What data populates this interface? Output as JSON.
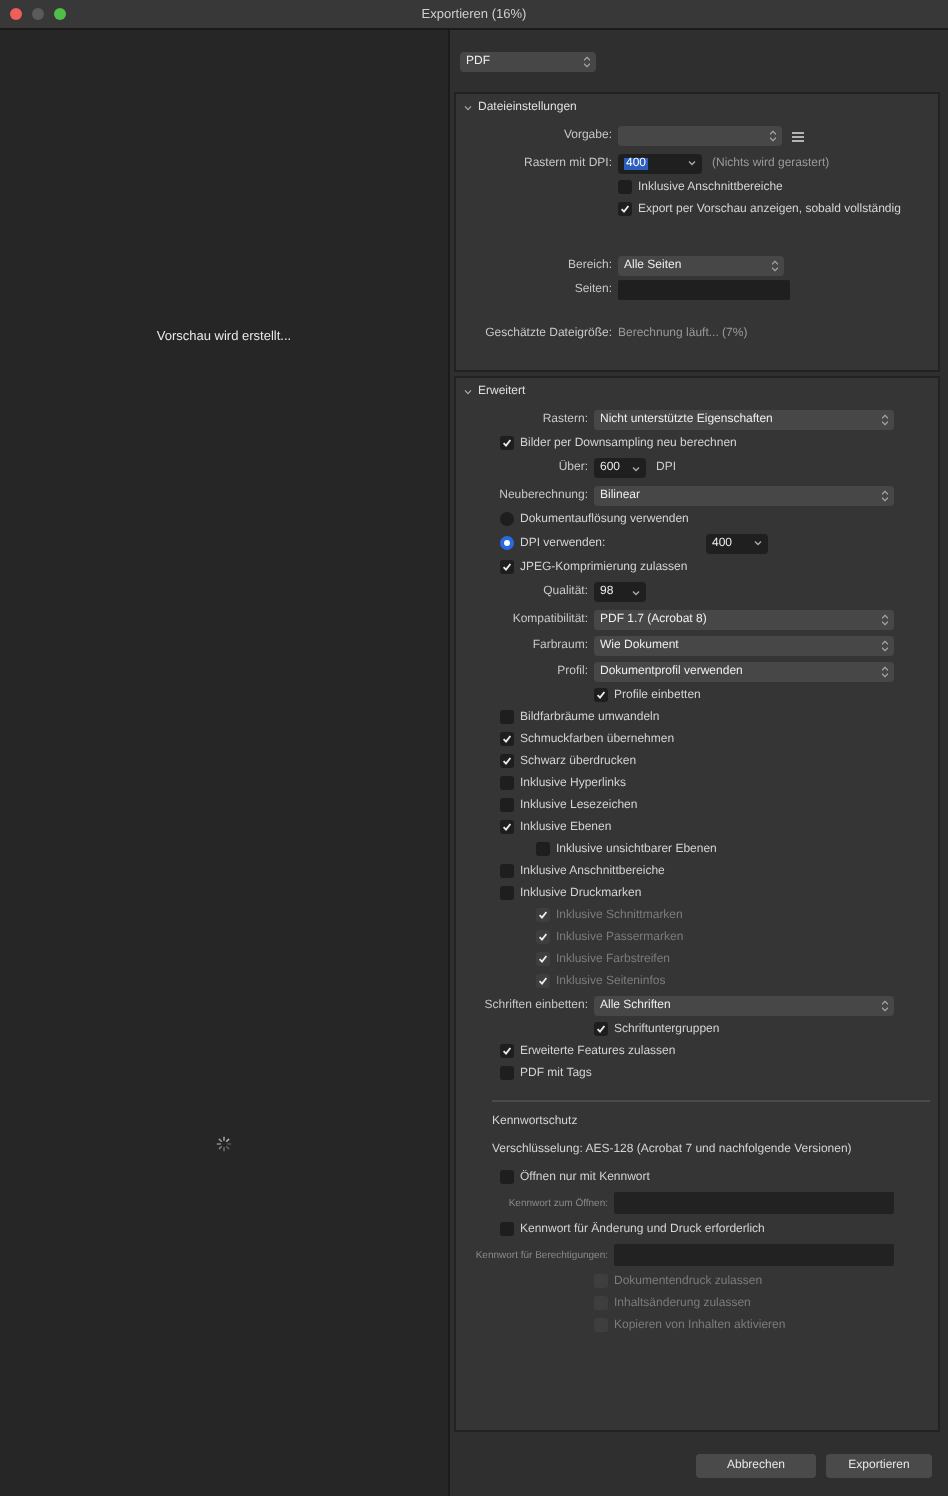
{
  "window": {
    "title": "Exportieren (16%)"
  },
  "preview": {
    "status": "Vorschau wird erstellt..."
  },
  "format": {
    "value": "PDF"
  },
  "file_settings": {
    "title": "Dateieinstellungen",
    "expanded": true,
    "preset": {
      "label": "Vorgabe:"
    },
    "raster_dpi": {
      "label": "Rastern mit DPI:",
      "value": "400",
      "note": "(Nichts wird gerastert)"
    },
    "checks": [
      {
        "label": "Inklusive Anschnittbereiche",
        "checked": false
      },
      {
        "label": "Export per Vorschau anzeigen, sobald vollständig",
        "checked": true
      }
    ],
    "range": {
      "label": "Bereich:",
      "value": "Alle Seiten"
    },
    "pages": {
      "label": "Seiten:"
    },
    "size": {
      "label": "Geschätzte Dateigröße:",
      "value": "Berechnung läuft... (7%)"
    }
  },
  "advanced": {
    "title": "Erweitert",
    "expanded": true,
    "items": [
      {
        "kind": "select",
        "label": "Rastern:",
        "value": "Nicht unterstützte Eigenschaften"
      },
      {
        "kind": "check",
        "label": "Bilder per Downsampling neu berechnen",
        "checked": true
      },
      {
        "kind": "number",
        "label": "Über:",
        "value": "600",
        "unit": "DPI"
      },
      {
        "kind": "select",
        "label": "Neuberechnung:",
        "value": "Bilinear"
      },
      {
        "kind": "radio",
        "label": "Dokumentauflösung verwenden",
        "selected": false
      },
      {
        "kind": "radio",
        "label": "DPI verwenden:",
        "selected": true,
        "value": "400"
      },
      {
        "kind": "check",
        "label": "JPEG-Komprimierung zulassen",
        "checked": true
      },
      {
        "kind": "number",
        "label": "Qualität:",
        "value": "98"
      },
      {
        "kind": "select",
        "label": "Kompatibilität:",
        "value": "PDF 1.7 (Acrobat 8)"
      },
      {
        "kind": "select",
        "label": "Farbraum:",
        "value": "Wie Dokument"
      },
      {
        "kind": "select",
        "label": "Profil:",
        "value": "Dokumentprofil verwenden",
        "children": [
          {
            "kind": "check",
            "label": "Profile einbetten",
            "checked": true
          }
        ]
      },
      {
        "kind": "check",
        "label": "Bildfarbräume umwandeln",
        "checked": false
      },
      {
        "kind": "check",
        "label": "Schmuckfarben übernehmen",
        "checked": true
      },
      {
        "kind": "check",
        "label": "Schwarz überdrucken",
        "checked": true
      },
      {
        "kind": "check",
        "label": "Inklusive Hyperlinks",
        "checked": false
      },
      {
        "kind": "check",
        "label": "Inklusive Lesezeichen",
        "checked": false
      },
      {
        "kind": "check",
        "label": "Inklusive Ebenen",
        "checked": true,
        "children": [
          {
            "kind": "check",
            "label": "Inklusive unsichtbarer Ebenen",
            "checked": false
          }
        ]
      },
      {
        "kind": "check",
        "label": "Inklusive Anschnittbereiche",
        "checked": false
      },
      {
        "kind": "check",
        "label": "Inklusive Druckmarken",
        "checked": false,
        "children": [
          {
            "kind": "check",
            "label": "Inklusive Schnittmarken",
            "checked": true,
            "disabled": true
          },
          {
            "kind": "check",
            "label": "Inklusive Passermarken",
            "checked": true,
            "disabled": true
          },
          {
            "kind": "check",
            "label": "Inklusive Farbstreifen",
            "checked": true,
            "disabled": true
          },
          {
            "kind": "check",
            "label": "Inklusive Seiteninfos",
            "checked": true,
            "disabled": true
          }
        ]
      },
      {
        "kind": "select",
        "label": "Schriften einbetten:",
        "value": "Alle Schriften",
        "children": [
          {
            "kind": "check",
            "label": "Schriftuntergruppen",
            "checked": true
          }
        ]
      },
      {
        "kind": "check",
        "label": "Erweiterte Features zulassen",
        "checked": true
      },
      {
        "kind": "check",
        "label": "PDF mit Tags",
        "checked": false
      },
      {
        "kind": "heading",
        "label": "Kennwortschutz"
      },
      {
        "kind": "text",
        "label": "Verschlüsselung: AES-128 (Acrobat 7 und nachfolgende Versionen)"
      },
      {
        "kind": "check",
        "label": "Öffnen nur mit Kennwort",
        "checked": false
      },
      {
        "kind": "field",
        "label": "Kennwort zum Öffnen:",
        "disabled": true
      },
      {
        "kind": "check",
        "label": "Kennwort für Änderung und Druck erforderlich",
        "checked": false
      },
      {
        "kind": "field",
        "label": "Kennwort für Berechtigungen:",
        "disabled": true,
        "children": [
          {
            "kind": "check",
            "label": "Dokumentendruck zulassen",
            "checked": false,
            "disabled": true
          },
          {
            "kind": "check",
            "label": "Inhaltsänderung zulassen",
            "checked": false,
            "disabled": true
          },
          {
            "kind": "check",
            "label": "Kopieren von Inhalten aktivieren",
            "checked": false,
            "disabled": true
          }
        ]
      }
    ]
  },
  "buttons": [
    "Abbrechen",
    "Exportieren"
  ]
}
